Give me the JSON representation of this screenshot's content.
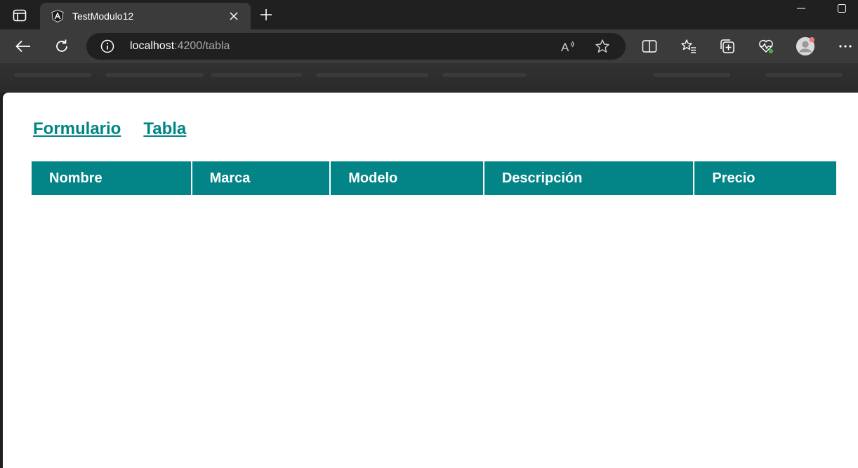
{
  "browser": {
    "tab": {
      "title": "TestModulo12"
    },
    "address": {
      "host": "localhost",
      "port_path": ":4200/tabla"
    },
    "colors": {
      "chrome_dark": "#202020",
      "toolbar": "#3b3b3b",
      "profile_dot": "#e87c7c",
      "health_dot": "#3fae49"
    }
  },
  "page": {
    "nav": {
      "link_formulario": "Formulario",
      "link_tabla": "Tabla"
    },
    "table": {
      "headers": [
        "Nombre",
        "Marca",
        "Modelo",
        "Descripción",
        "Precio"
      ],
      "rows": []
    },
    "colors": {
      "accent": "#008585",
      "header_bg": "#038487"
    }
  }
}
